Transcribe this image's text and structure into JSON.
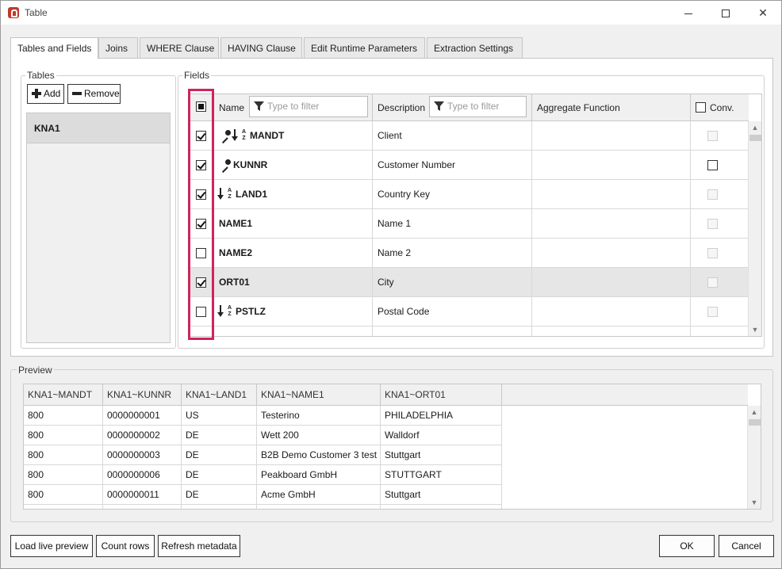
{
  "window": {
    "title": "Table"
  },
  "tabs": [
    {
      "label": "Tables and Fields",
      "active": true
    },
    {
      "label": "Joins",
      "active": false
    },
    {
      "label": "WHERE Clause",
      "active": false
    },
    {
      "label": "HAVING Clause",
      "active": false
    },
    {
      "label": "Edit Runtime Parameters",
      "active": false
    },
    {
      "label": "Extraction Settings",
      "active": false
    }
  ],
  "tables": {
    "group_label": "Tables",
    "add_label": "Add",
    "remove_label": "Remove",
    "items": [
      "KNA1"
    ]
  },
  "fields": {
    "group_label": "Fields",
    "header": {
      "select_all_state": "indeterminate",
      "name": "Name",
      "name_filter_placeholder": "Type to filter",
      "description": "Description",
      "description_filter_placeholder": "Type to filter",
      "aggregate": "Aggregate Function",
      "conv": "Conv."
    },
    "rows": [
      {
        "checked": true,
        "key": true,
        "sorted": true,
        "name": "MANDT",
        "description": "Client",
        "aggregate": "",
        "conv": "disabled",
        "selected": false
      },
      {
        "checked": true,
        "key": true,
        "sorted": false,
        "name": "KUNNR",
        "description": "Customer Number",
        "aggregate": "",
        "conv": "enabled",
        "selected": false
      },
      {
        "checked": true,
        "key": false,
        "sorted": true,
        "name": "LAND1",
        "description": "Country Key",
        "aggregate": "",
        "conv": "disabled",
        "selected": false
      },
      {
        "checked": true,
        "key": false,
        "sorted": false,
        "name": "NAME1",
        "description": "Name 1",
        "aggregate": "",
        "conv": "disabled",
        "selected": false
      },
      {
        "checked": false,
        "key": false,
        "sorted": false,
        "name": "NAME2",
        "description": "Name 2",
        "aggregate": "",
        "conv": "disabled",
        "selected": false
      },
      {
        "checked": true,
        "key": false,
        "sorted": false,
        "name": "ORT01",
        "description": "City",
        "aggregate": "",
        "conv": "disabled",
        "selected": true
      },
      {
        "checked": false,
        "key": false,
        "sorted": true,
        "name": "PSTLZ",
        "description": "Postal Code",
        "aggregate": "",
        "conv": "disabled",
        "selected": false
      }
    ],
    "sort_icon_text_top": "A",
    "sort_icon_text_bottom": "Z"
  },
  "preview": {
    "label": "Preview",
    "columns": [
      "KNA1~MANDT",
      "KNA1~KUNNR",
      "KNA1~LAND1",
      "KNA1~NAME1",
      "KNA1~ORT01"
    ],
    "rows": [
      [
        "800",
        "0000000001",
        "US",
        "Testerino",
        "PHILADELPHIA"
      ],
      [
        "800",
        "0000000002",
        "DE",
        "Wett 200",
        "Walldorf"
      ],
      [
        "800",
        "0000000003",
        "DE",
        "B2B Demo Customer 3 test",
        "Stuttgart"
      ],
      [
        "800",
        "0000000006",
        "DE",
        "Peakboard GmbH",
        "STUTTGART"
      ],
      [
        "800",
        "0000000011",
        "DE",
        "Acme GmbH",
        "Stuttgart"
      ]
    ]
  },
  "footer": {
    "load_live_preview": "Load live preview",
    "count_rows": "Count rows",
    "refresh_metadata": "Refresh metadata",
    "ok": "OK",
    "cancel": "Cancel"
  },
  "colors": {
    "highlight": "#d0245a"
  }
}
